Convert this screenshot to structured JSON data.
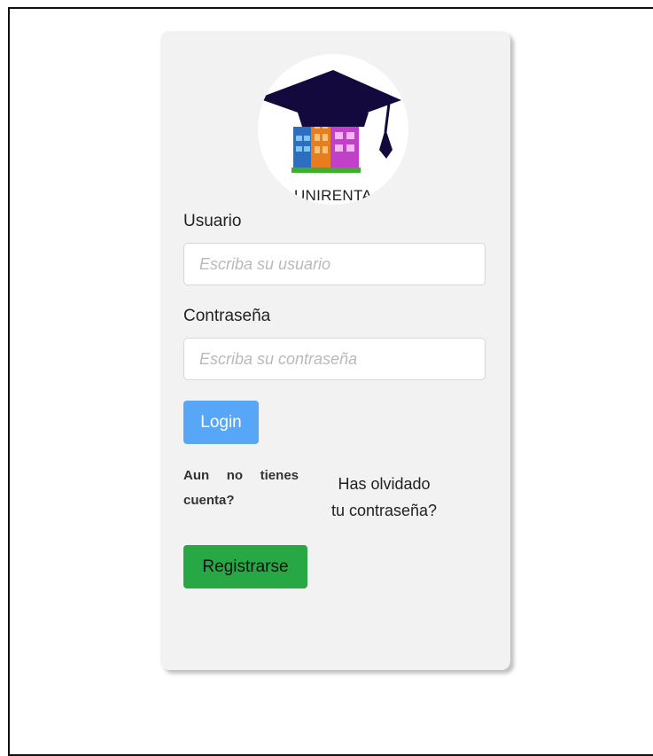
{
  "logo": {
    "text": "UNIRENTA",
    "colors": {
      "cap": "#13093d",
      "building_blue": "#2d6fbf",
      "building_orange": "#e87d1e",
      "building_magenta": "#c040c8",
      "ground": "#3fae2f"
    }
  },
  "form": {
    "username_label": "Usuario",
    "username_placeholder": "Escriba su usuario",
    "password_label": "Contraseña",
    "password_placeholder": "Escriba su contraseña",
    "login_label": "Login",
    "signup_prompt": "Aun no tienes cuenta?",
    "forgot_line1": "Has olvidado",
    "forgot_line2": "tu contraseña?",
    "register_label": "Registrarse"
  }
}
